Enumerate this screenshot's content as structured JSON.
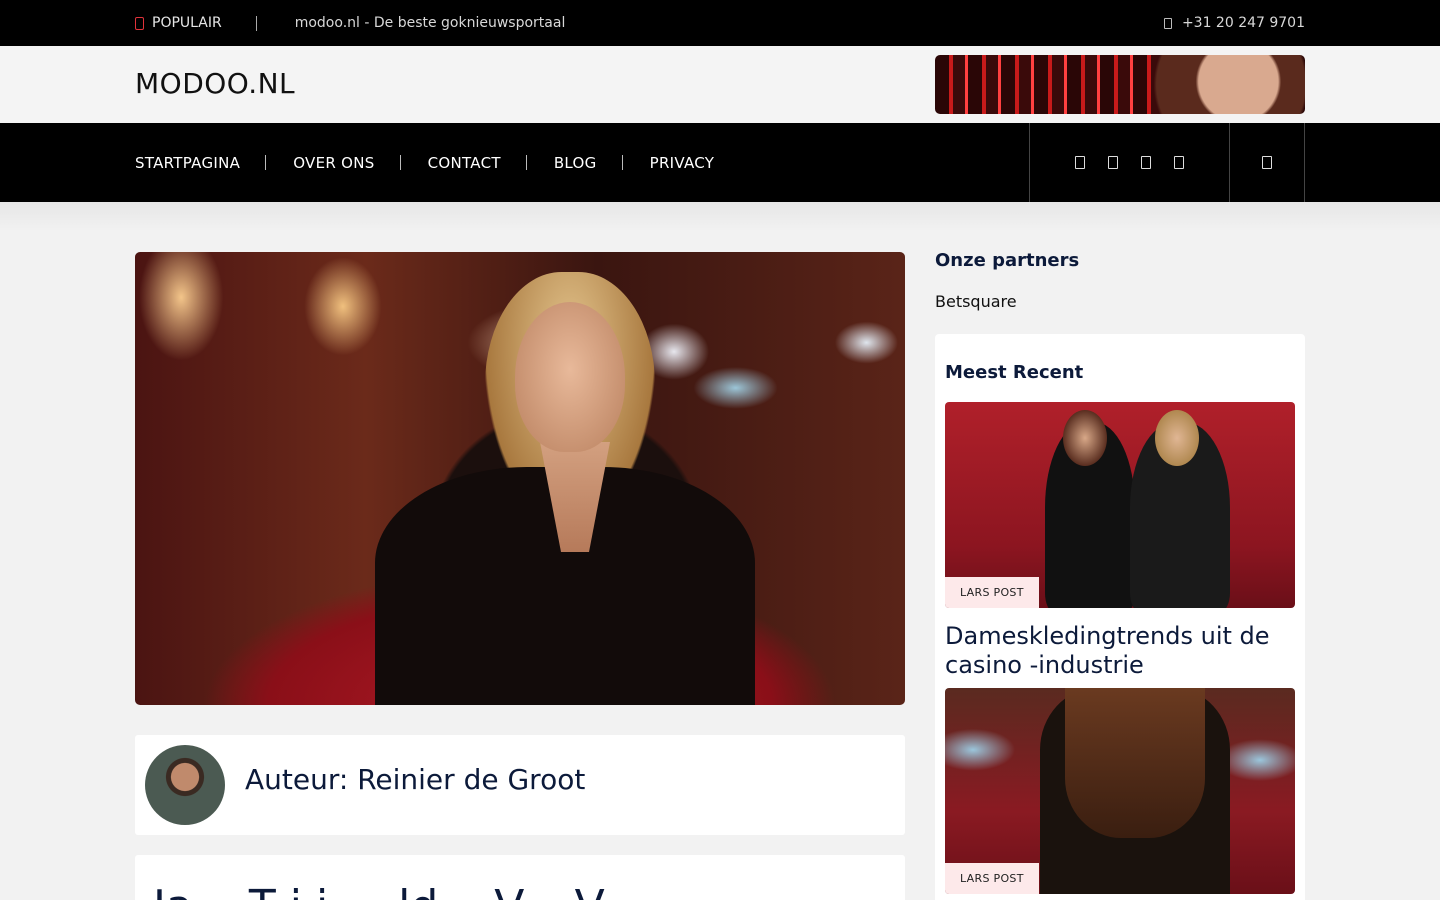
{
  "topbar": {
    "popular_label": "POPULAIR",
    "tagline": "modoo.nl - De beste goknieuwsportaal",
    "phone": "+31 20 247 9701"
  },
  "header": {
    "logo": "MODOO.NL"
  },
  "nav": {
    "items": [
      {
        "label": "STARTPAGINA"
      },
      {
        "label": "OVER ONS"
      },
      {
        "label": "CONTACT"
      },
      {
        "label": "BLOG"
      },
      {
        "label": "PRIVACY"
      }
    ],
    "social_icons": [
      "social-icon-1",
      "social-icon-2",
      "social-icon-3",
      "social-icon-4"
    ],
    "search_icon": "search-icon"
  },
  "main": {
    "author_title": "Auteur: Reinier de Groot",
    "post_title_partial": "Ja... T i i ... ld... V... V..."
  },
  "sidebar": {
    "partners_heading": "Onze partners",
    "partner_link": "Betsquare",
    "recent_heading": "Meest Recent",
    "posts": [
      {
        "badge": "LARS POST",
        "title": "Dameskledingtrends uit de casino -industrie"
      },
      {
        "badge": "LARS POST"
      }
    ]
  },
  "colors": {
    "topbar_bg": "#000000",
    "nav_bg": "#000000",
    "accent_red": "#e0323a",
    "heading_navy": "#0c1a3a",
    "badge_bg": "#fde9ea"
  }
}
